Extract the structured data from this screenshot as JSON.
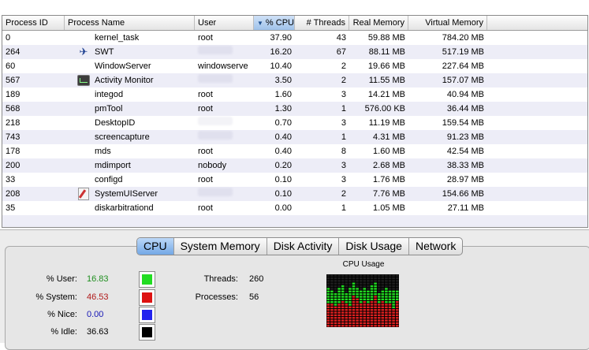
{
  "table": {
    "columns": [
      {
        "label": "Process ID",
        "cls": "c-pid",
        "num": false
      },
      {
        "label": "Process Name",
        "cls": "c-name",
        "num": false
      },
      {
        "label": "User",
        "cls": "c-user",
        "num": false
      },
      {
        "label": "% CPU",
        "cls": "c-cpu",
        "num": true,
        "sorted": true
      },
      {
        "label": "# Threads",
        "cls": "c-thr",
        "num": true
      },
      {
        "label": "Real Memory",
        "cls": "c-real",
        "num": true
      },
      {
        "label": "Virtual Memory",
        "cls": "c-virt",
        "num": true
      }
    ],
    "rows": [
      {
        "pid": "0",
        "name": "kernel_task",
        "icon": "",
        "user": "root",
        "cpu": "37.90",
        "threads": "43",
        "real": "59.88 MB",
        "virt": "784.20 MB"
      },
      {
        "pid": "264",
        "name": "SWT",
        "icon": "swt-icon",
        "user": "",
        "cpu": "16.20",
        "threads": "67",
        "real": "88.11 MB",
        "virt": "517.19 MB"
      },
      {
        "pid": "60",
        "name": "WindowServer",
        "icon": "",
        "user": "windowserve",
        "cpu": "10.40",
        "threads": "2",
        "real": "19.66 MB",
        "virt": "227.64 MB"
      },
      {
        "pid": "567",
        "name": "Activity Monitor",
        "icon": "activity-monitor-icon",
        "user": "",
        "cpu": "3.50",
        "threads": "2",
        "real": "11.55 MB",
        "virt": "157.07 MB"
      },
      {
        "pid": "189",
        "name": "integod",
        "icon": "",
        "user": "root",
        "cpu": "1.60",
        "threads": "3",
        "real": "14.21 MB",
        "virt": "40.94 MB"
      },
      {
        "pid": "568",
        "name": "pmTool",
        "icon": "",
        "user": "root",
        "cpu": "1.30",
        "threads": "1",
        "real": "576.00 KB",
        "virt": "36.44 MB"
      },
      {
        "pid": "218",
        "name": "DesktopID",
        "icon": "",
        "user": "",
        "cpu": "0.70",
        "threads": "3",
        "real": "11.19 MB",
        "virt": "159.54 MB"
      },
      {
        "pid": "743",
        "name": "screencapture",
        "icon": "",
        "user": "",
        "cpu": "0.40",
        "threads": "1",
        "real": "4.31 MB",
        "virt": "91.23 MB"
      },
      {
        "pid": "178",
        "name": "mds",
        "icon": "",
        "user": "root",
        "cpu": "0.40",
        "threads": "8",
        "real": "1.60 MB",
        "virt": "42.54 MB"
      },
      {
        "pid": "200",
        "name": "mdimport",
        "icon": "",
        "user": "nobody",
        "cpu": "0.20",
        "threads": "3",
        "real": "2.68 MB",
        "virt": "38.33 MB"
      },
      {
        "pid": "33",
        "name": "configd",
        "icon": "",
        "user": "root",
        "cpu": "0.10",
        "threads": "3",
        "real": "1.76 MB",
        "virt": "28.97 MB"
      },
      {
        "pid": "208",
        "name": "SystemUIServer",
        "icon": "system-ui-server-icon",
        "user": "",
        "cpu": "0.10",
        "threads": "2",
        "real": "7.76 MB",
        "virt": "154.66 MB"
      },
      {
        "pid": "35",
        "name": "diskarbitrationd",
        "icon": "",
        "user": "root",
        "cpu": "0.00",
        "threads": "1",
        "real": "1.05 MB",
        "virt": "27.11 MB"
      }
    ]
  },
  "tabs": [
    "CPU",
    "System Memory",
    "Disk Activity",
    "Disk Usage",
    "Network"
  ],
  "active_tab": "CPU",
  "cpu_stats": [
    {
      "label": "% User:",
      "value": "16.83",
      "color": "#1f8f1f",
      "swatch": "#22dd22"
    },
    {
      "label": "% System:",
      "value": "46.53",
      "color": "#b01818",
      "swatch": "#dd1111"
    },
    {
      "label": "% Nice:",
      "value": "0.00",
      "color": "#1515b5",
      "swatch": "#2222ee"
    },
    {
      "label": "% Idle:",
      "value": "36.63",
      "color": "#000000",
      "swatch": "#000000"
    }
  ],
  "threads": {
    "label": "Threads:",
    "value": "260"
  },
  "processes": {
    "label": "Processes:",
    "value": "56"
  },
  "cpu_usage_title": "CPU Usage",
  "cpu_usage_history": [
    {
      "user": 0.28,
      "system": 0.45
    },
    {
      "user": 0.25,
      "system": 0.47
    },
    {
      "user": 0.25,
      "system": 0.42
    },
    {
      "user": 0.3,
      "system": 0.46
    },
    {
      "user": 0.32,
      "system": 0.49
    },
    {
      "user": 0.22,
      "system": 0.44
    },
    {
      "user": 0.35,
      "system": 0.4
    },
    {
      "user": 0.26,
      "system": 0.62
    },
    {
      "user": 0.2,
      "system": 0.53
    },
    {
      "user": 0.26,
      "system": 0.45
    },
    {
      "user": 0.25,
      "system": 0.49
    },
    {
      "user": 0.25,
      "system": 0.46
    },
    {
      "user": 0.28,
      "system": 0.5
    },
    {
      "user": 0.24,
      "system": 0.61
    },
    {
      "user": 0.2,
      "system": 0.46
    },
    {
      "user": 0.22,
      "system": 0.52
    },
    {
      "user": 0.31,
      "system": 0.44
    },
    {
      "user": 0.27,
      "system": 0.47
    },
    {
      "user": 0.36,
      "system": 0.37
    },
    {
      "user": 0.2,
      "system": 0.48
    }
  ],
  "colors": {
    "user_bar": "#22dd22",
    "system_bar": "#e02020",
    "idle_bar": "#1e1e1e"
  }
}
